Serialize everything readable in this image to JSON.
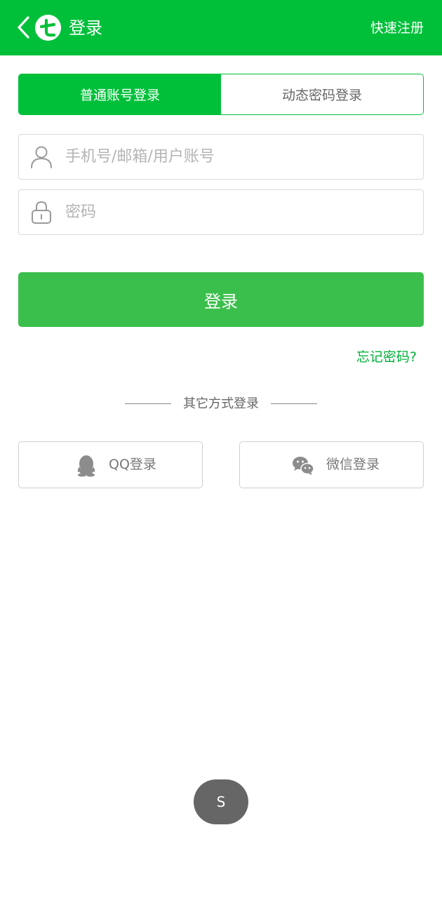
{
  "header": {
    "title": "登录",
    "register_label": "快速注册",
    "back_icon": "chevron-left-icon",
    "logo_icon": "brand-logo-icon",
    "background_color": "#00c03a"
  },
  "tabs": [
    {
      "label": "普通账号登录",
      "active": true
    },
    {
      "label": "动态密码登录",
      "active": false
    }
  ],
  "form": {
    "account": {
      "placeholder": "手机号/邮箱/用户账号",
      "value": "",
      "icon": "user-icon"
    },
    "password": {
      "placeholder": "密码",
      "value": "",
      "icon": "lock-icon"
    },
    "submit_label": "登录",
    "forgot_label": "忘记密码?"
  },
  "other_login": {
    "divider_label": "其它方式登录",
    "qq_label": "QQ登录",
    "qq_icon": "qq-penguin-icon",
    "wechat_label": "微信登录",
    "wechat_icon": "wechat-icon"
  },
  "floating_button": {
    "label": "S"
  },
  "colors": {
    "accent": "#00c03a",
    "button": "#3bbf4c",
    "link": "#00b23a"
  }
}
